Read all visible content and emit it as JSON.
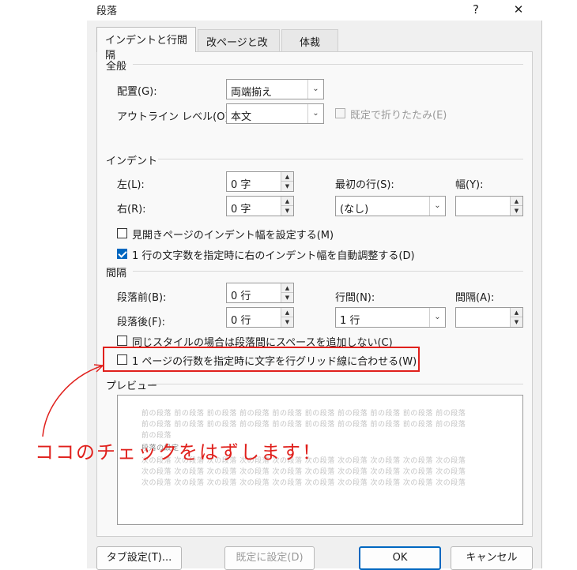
{
  "dialog": {
    "title": "段落",
    "help_label": "?",
    "close_label": "✕"
  },
  "tabs": [
    {
      "label": "インデントと行間隔",
      "active": true
    },
    {
      "label": "改ページと改行",
      "active": false
    },
    {
      "label": "体裁",
      "active": false
    }
  ],
  "general": {
    "heading": "全般",
    "alignment_label": "配置(G):",
    "alignment_value": "両端揃え",
    "outline_label": "アウトライン レベル(O):",
    "outline_value": "本文",
    "collapse_label": "既定で折りたたみ(E)"
  },
  "indent": {
    "heading": "インデント",
    "left_label": "左(L):",
    "left_value": "0 字",
    "right_label": "右(R):",
    "right_value": "0 字",
    "first_line_label": "最初の行(S):",
    "first_line_value": "(なし)",
    "width_label": "幅(Y):",
    "width_value": "",
    "mirror_label": "見開きページのインデント幅を設定する(M)",
    "auto_adjust_label": "1 行の文字数を指定時に右のインデント幅を自動調整する(D)"
  },
  "spacing": {
    "heading": "間隔",
    "before_label": "段落前(B):",
    "before_value": "0 行",
    "after_label": "段落後(F):",
    "after_value": "0 行",
    "line_spacing_label": "行間(N):",
    "line_spacing_value": "1 行",
    "at_label": "間隔(A):",
    "at_value": "",
    "no_space_same_style_label": "同じスタイルの場合は段落間にスペースを追加しない(C)",
    "snap_to_grid_label": "1 ページの行数を指定時に文字を行グリッド線に合わせる(W)"
  },
  "preview": {
    "heading": "プレビュー",
    "prev_line": "前の段落 前の段落 前の段落 前の段落 前の段落 前の段落 前の段落 前の段落 前の段落 前の段落",
    "prev_short": "前の段落",
    "sample_text": "段落の設定",
    "next_line": "次の段落 次の段落 次の段落 次の段落 次の段落 次の段落 次の段落 次の段落 次の段落 次の段落"
  },
  "buttons": {
    "tabs": "タブ設定(T)...",
    "default": "既定に設定(D)",
    "ok": "OK",
    "cancel": "キャンセル"
  },
  "annotation": {
    "text": "ココのチェックをはずします！",
    "color": "#e0201c"
  }
}
